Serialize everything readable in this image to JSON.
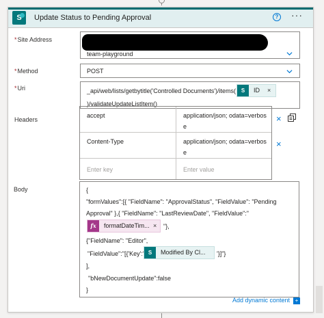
{
  "card": {
    "title": "Update Status to Pending Approval",
    "help_glyph": "?",
    "more_glyph": "···"
  },
  "site_address": {
    "label": "Site Address",
    "value": "team-playground"
  },
  "method": {
    "label": "Method",
    "value": "POST"
  },
  "uri": {
    "label": "Uri",
    "line1": "_api/web/lists/getbytitle('Controlled Documents')/items(",
    "token": "ID",
    "line2": ")/validateUpdateListItem()"
  },
  "headers": {
    "label": "Headers",
    "rows": [
      {
        "key": "accept",
        "value_line1": "application/json; odata=verbos",
        "value_line2": "e"
      },
      {
        "key": "Content-Type",
        "value_line1": "application/json; odata=verbos",
        "value_line2": "e"
      }
    ],
    "key_placeholder": "Enter key",
    "value_placeholder": "Enter value"
  },
  "body": {
    "label": "Body",
    "lines": [
      "{",
      "\"formValues\":[{ \"FieldName\": \"ApprovalStatus\", \"FieldValue\": \"Pending",
      "Approval\" },{ \"FieldName\": \"LastReviewDate\", \"FieldValue\":\"",
      "\"},",
      "{\"FieldName\": \"Editor\",",
      "\"FieldValue\":\"[{'Key':'",
      "'}]\"}",
      "],",
      "\"bNewDocumentUpdate\":false",
      "}"
    ],
    "fx_token": "formatDateTim...",
    "modified_token": "Modified By Cl...",
    "add_dynamic": "Add dynamic content"
  },
  "glyphs": {
    "close": "×",
    "sp": "S",
    "fx": "fx"
  }
}
